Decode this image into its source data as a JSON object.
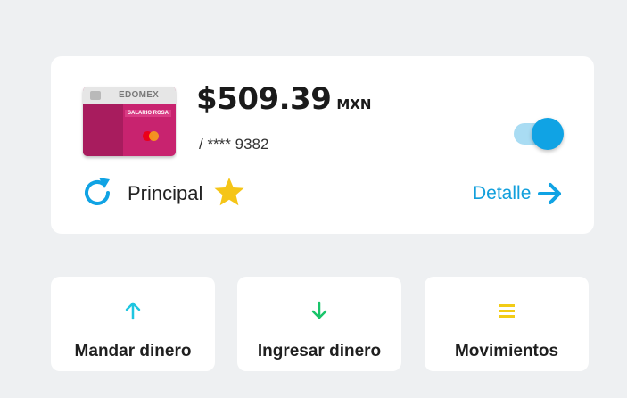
{
  "account": {
    "card_brand": "EDOMEX",
    "card_label": "SALARIO ROSA",
    "balance": "$509.39",
    "currency": "MXN",
    "masked_number": "/ **** 9382",
    "account_label": "Principal",
    "detail_label": "Detalle",
    "toggle_on": true
  },
  "icons": {
    "refresh": "refresh-icon",
    "star": "star-icon",
    "detail_arrow": "arrow-right-icon",
    "send": "arrow-up-icon",
    "receive": "arrow-down-icon",
    "movements": "menu-lines-icon"
  },
  "actions": {
    "send_label": "Mandar dinero",
    "receive_label": "Ingresar dinero",
    "movements_label": "Movimientos"
  },
  "colors": {
    "background": "#eef0f2",
    "accent_blue": "#10a3e4",
    "toggle_track": "#a9dcf3",
    "star_yellow": "#f5c518",
    "send_icon": "#1fc6e0",
    "receive_icon": "#19c46a",
    "movements_icon": "#f2cc16",
    "card_pink": "#c8236f"
  }
}
